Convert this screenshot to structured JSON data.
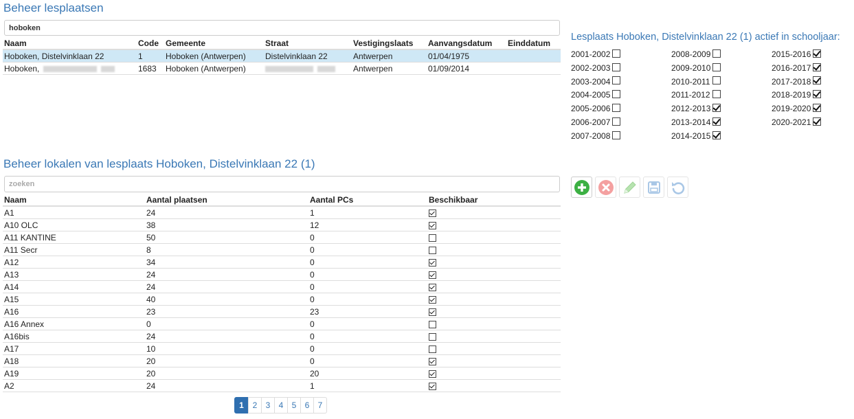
{
  "headings": {
    "locations": "Beheer lesplaatsen",
    "rooms": "Beheer lokalen van lesplaats Hoboken, Distelvinklaan 22 (1)",
    "years": "Lesplaats Hoboken, Distelvinklaan 22 (1) actief in schooljaar:"
  },
  "location_search": {
    "value": "hoboken"
  },
  "locations": {
    "columns": [
      "Naam",
      "Code",
      "Gemeente",
      "Straat",
      "Vestigingslaats",
      "Aanvangsdatum",
      "Einddatum"
    ],
    "rows": [
      {
        "naam": "Hoboken, Distelvinklaan 22",
        "code": "1",
        "gemeente": "Hoboken (Antwerpen)",
        "straat": "Distelvinklaan 22",
        "vestiging": "Antwerpen",
        "aanvang": "01/04/1975",
        "einde": ""
      },
      {
        "naam": "Hoboken,",
        "code": "1683",
        "gemeente": "Hoboken (Antwerpen)",
        "straat": "",
        "vestiging": "Antwerpen",
        "aanvang": "01/09/2014",
        "einde": ""
      }
    ]
  },
  "school_years": [
    {
      "label": "2001-2002",
      "checked": false
    },
    {
      "label": "2002-2003",
      "checked": false
    },
    {
      "label": "2003-2004",
      "checked": false
    },
    {
      "label": "2004-2005",
      "checked": false
    },
    {
      "label": "2005-2006",
      "checked": false
    },
    {
      "label": "2006-2007",
      "checked": false
    },
    {
      "label": "2007-2008",
      "checked": false
    },
    {
      "label": "2008-2009",
      "checked": false
    },
    {
      "label": "2009-2010",
      "checked": false
    },
    {
      "label": "2010-2011",
      "checked": false
    },
    {
      "label": "2011-2012",
      "checked": false
    },
    {
      "label": "2012-2013",
      "checked": true
    },
    {
      "label": "2013-2014",
      "checked": true
    },
    {
      "label": "2014-2015",
      "checked": true
    },
    {
      "label": "2015-2016",
      "checked": true
    },
    {
      "label": "2016-2017",
      "checked": true
    },
    {
      "label": "2017-2018",
      "checked": true
    },
    {
      "label": "2018-2019",
      "checked": true
    },
    {
      "label": "2019-2020",
      "checked": true
    },
    {
      "label": "2020-2021",
      "checked": true
    }
  ],
  "room_search": {
    "placeholder": "zoeken"
  },
  "toolbar": {
    "add": "add-icon",
    "delete": "delete-icon",
    "edit": "edit-icon",
    "save": "save-icon",
    "undo": "undo-icon"
  },
  "rooms": {
    "columns": [
      "Naam",
      "Aantal plaatsen",
      "Aantal PCs",
      "Beschikbaar"
    ],
    "rows": [
      {
        "naam": "A1",
        "plaatsen": "24",
        "pcs": "1",
        "beschikbaar": true
      },
      {
        "naam": "A10 OLC",
        "plaatsen": "38",
        "pcs": "12",
        "beschikbaar": true
      },
      {
        "naam": "A11 KANTINE",
        "plaatsen": "50",
        "pcs": "0",
        "beschikbaar": false
      },
      {
        "naam": "A11 Secr",
        "plaatsen": "8",
        "pcs": "0",
        "beschikbaar": false
      },
      {
        "naam": "A12",
        "plaatsen": "34",
        "pcs": "0",
        "beschikbaar": true
      },
      {
        "naam": "A13",
        "plaatsen": "24",
        "pcs": "0",
        "beschikbaar": true
      },
      {
        "naam": "A14",
        "plaatsen": "24",
        "pcs": "0",
        "beschikbaar": true
      },
      {
        "naam": "A15",
        "plaatsen": "40",
        "pcs": "0",
        "beschikbaar": true
      },
      {
        "naam": "A16",
        "plaatsen": "23",
        "pcs": "23",
        "beschikbaar": true
      },
      {
        "naam": "A16 Annex",
        "plaatsen": "0",
        "pcs": "0",
        "beschikbaar": false
      },
      {
        "naam": "A16bis",
        "plaatsen": "24",
        "pcs": "0",
        "beschikbaar": false
      },
      {
        "naam": "A17",
        "plaatsen": "10",
        "pcs": "0",
        "beschikbaar": false
      },
      {
        "naam": "A18",
        "plaatsen": "20",
        "pcs": "0",
        "beschikbaar": true
      },
      {
        "naam": "A19",
        "plaatsen": "20",
        "pcs": "20",
        "beschikbaar": true
      },
      {
        "naam": "A2",
        "plaatsen": "24",
        "pcs": "1",
        "beschikbaar": true
      }
    ]
  },
  "pagination": {
    "pages": [
      "1",
      "2",
      "3",
      "4",
      "5",
      "6",
      "7"
    ],
    "current": "1"
  },
  "colors": {
    "heading": "#3a78b5",
    "selected_row": "#cfe8f6",
    "active_page": "#2f6fb0",
    "add": "#3cb043",
    "delete": "#f08b8b",
    "edit": "#a8dba0",
    "save": "#9fc1e3",
    "undo": "#9fc1e3"
  }
}
